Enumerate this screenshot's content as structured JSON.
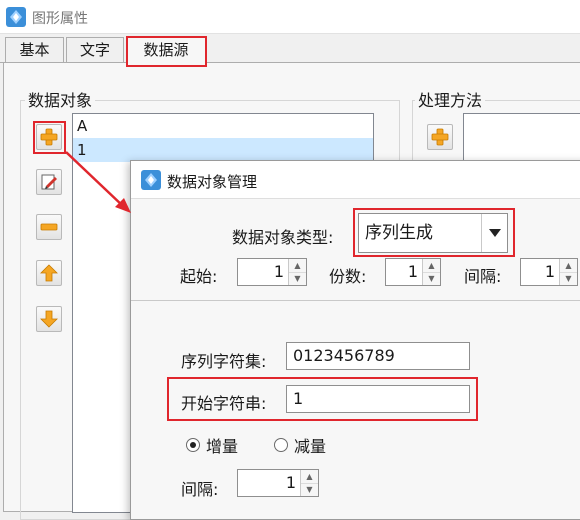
{
  "window": {
    "title": "图形属性",
    "icon": "app-diamond-icon"
  },
  "tabs": [
    {
      "label": "基本",
      "active": false
    },
    {
      "label": "文字",
      "active": false
    },
    {
      "label": "数据源",
      "active": true
    }
  ],
  "data_objects": {
    "group_label": "数据对象",
    "items": [
      {
        "label": "A",
        "selected": false
      },
      {
        "label": "1",
        "selected": true
      }
    ],
    "toolbar": [
      "add-icon",
      "edit-icon",
      "remove-icon",
      "move-up-icon",
      "move-down-icon"
    ]
  },
  "processing": {
    "group_label": "处理方法",
    "toolbar": [
      "add-icon"
    ]
  },
  "dialog": {
    "title": "数据对象管理",
    "type_label": "数据对象类型:",
    "type_value": "序列生成",
    "start_label": "起始:",
    "start_value": "1",
    "copies_label": "份数:",
    "copies_value": "1",
    "interval_label": "间隔:",
    "interval_value": "1",
    "charset_label": "序列字符集:",
    "charset_value": "0123456789",
    "start_string_label": "开始字符串:",
    "start_string_value": "1",
    "increase_label": "增量",
    "decrease_label": "减量",
    "increase_selected": true,
    "step_label": "间隔:",
    "step_value": "1"
  },
  "colors": {
    "highlight": "#e0262d",
    "selection": "#cce8ff",
    "icon_orange": "#f5a623"
  }
}
